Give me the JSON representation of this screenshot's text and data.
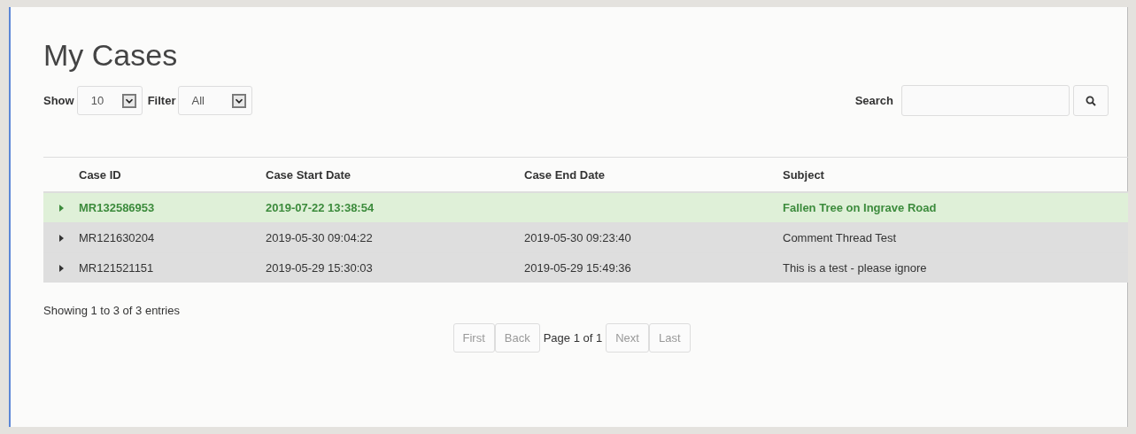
{
  "title": "My Cases",
  "show": {
    "label": "Show",
    "value": "10"
  },
  "filter": {
    "label": "Filter",
    "value": "All"
  },
  "search": {
    "label": "Search"
  },
  "table": {
    "columns": [
      "Case ID",
      "Case Start Date",
      "Case End Date",
      "Subject"
    ],
    "rows": [
      {
        "selected": true,
        "cells": [
          "MR132586953",
          "2019-07-22 13:38:54",
          "",
          "Fallen Tree on Ingrave Road"
        ]
      },
      {
        "selected": false,
        "cells": [
          "MR121630204",
          "2019-05-30 09:04:22",
          "2019-05-30 09:23:40",
          "Comment Thread Test"
        ]
      },
      {
        "selected": false,
        "cells": [
          "MR121521151",
          "2019-05-29 15:30:03",
          "2019-05-29 15:49:36",
          "This is a test - please ignore"
        ]
      }
    ]
  },
  "info": "Showing 1 to 3 of 3 entries",
  "pager": {
    "buttons": [
      {
        "label": "First",
        "disabled": true
      },
      {
        "label": "Back",
        "disabled": true
      }
    ],
    "page": "Page 1 of 1",
    "buttons_after": [
      {
        "label": "Next",
        "disabled": true
      },
      {
        "label": "Last",
        "disabled": true
      }
    ]
  }
}
